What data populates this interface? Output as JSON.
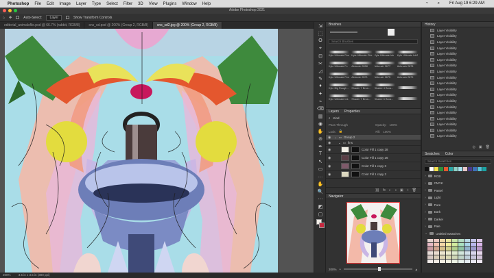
{
  "menubar": {
    "apple": "",
    "items": [
      "Photoshop",
      "File",
      "Edit",
      "Image",
      "Layer",
      "Type",
      "Select",
      "Filter",
      "3D",
      "View",
      "Plugins",
      "Window",
      "Help"
    ],
    "datetime": "Fri Aug 19  6:29 AM"
  },
  "window": {
    "title": "Adobe Photoshop 2021"
  },
  "options": {
    "auto_select": "Auto-Select:",
    "layer": "Layer",
    "show_transform": "Show Transform Controls"
  },
  "doc_tabs": [
    {
      "label": "editorial_animalsfile.psd @ 66.7% (rabbit, RGB/8)",
      "active": false
    },
    {
      "label": "sns_sd.psd @ 200% (Group 2, RGB/8)",
      "active": false
    },
    {
      "label": "sns_sd2.jpg @ 200% (Group 2, RGB/8)",
      "active": true
    }
  ],
  "tools": [
    "⇲",
    "⬚",
    "ʘ",
    "⌖",
    "⊡",
    "✂",
    "◿",
    "✎",
    "♦",
    "✦",
    "⌁",
    "⌫",
    "▥",
    "◉",
    "✋",
    "⊘",
    "✒",
    "T",
    "↖",
    "▭",
    "…",
    "✋",
    "🔍",
    "⋯",
    "◩",
    "▢"
  ],
  "brushes": {
    "title": "Brushes",
    "search": "Search Brushes",
    "items": [
      "Kyle Ultimate Pen",
      "Kyle Ultimate Chk",
      "Kyle Ultimate Ink",
      "Kyle Ultimate Ink2",
      "Kyle Ultimate Fx",
      "Airbrush 2658",
      "Airbrush 2677",
      "Airbrush 2678",
      "Kyle Ultimate Pen",
      "Airbrush 2671",
      "Airbrush 2675",
      "Airbrush 2679",
      "Kyle Big Rough ...",
      "Shader 7 Broa...",
      "Shader 4 Broa...",
      "",
      "Kyle Ultimate Ink ...",
      "Shader 7 Broa...",
      "Shader 6 Broa...",
      ""
    ]
  },
  "layers": {
    "tabs": [
      "Layers",
      "Properties"
    ],
    "kind": "Kind",
    "blend": "Pass Through",
    "opacity_label": "Opacity:",
    "opacity": "100%",
    "lock_label": "Lock:",
    "fill_label": "Fill:",
    "fill": "100%",
    "rows": [
      {
        "name": "Group 2",
        "type": "group",
        "active": true
      },
      {
        "name": "fins",
        "type": "group",
        "active": false
      },
      {
        "name": "Color Fill 1 copy 28",
        "type": "layer",
        "active": false
      },
      {
        "name": "Color Fill 1 copy 26",
        "type": "layer",
        "active": false
      },
      {
        "name": "Color Fill 1 copy 3",
        "type": "layer",
        "active": false
      },
      {
        "name": "Color Fill 1 copy 2",
        "type": "layer",
        "active": false
      }
    ],
    "footer": [
      "⛓",
      "fx",
      "◐",
      "◑",
      "▣",
      "+",
      "🗑"
    ]
  },
  "navigator": {
    "title": "Navigator",
    "zoom": "200%"
  },
  "history": {
    "title": "History",
    "items": [
      "Layer Visibility",
      "Layer Visibility",
      "Layer Visibility",
      "Layer Visibility",
      "Layer Visibility",
      "Layer Visibility",
      "Layer Visibility",
      "Layer Visibility",
      "Layer Visibility",
      "Layer Visibility",
      "Layer Visibility",
      "Layer Visibility",
      "Layer Visibility",
      "Layer Visibility",
      "Layer Visibility",
      "Layer Visibility",
      "Layer Visibility",
      "Layer Visibility",
      "Layer Visibility"
    ]
  },
  "swatches": {
    "tabs": [
      "Swatches",
      "Color"
    ],
    "search": "Search Swatches",
    "recent": [
      "#111111",
      "#ffffff",
      "#f4e04d",
      "#2d8f3c",
      "#e4572e",
      "#2ba7a7",
      "#8ed1c6",
      "#a6e2f0",
      "#e7c6c7",
      "#4b3b8c",
      "#3d6fb6",
      "#55c1d8",
      "#1aa4a4"
    ],
    "folders": [
      "RGB",
      "CMYK",
      "Pastel",
      "Light",
      "Pure",
      "Dark",
      "Darker",
      "Pale",
      "Untitled Swatches"
    ],
    "palette": [
      "#e8d3d0",
      "#ebc7c1",
      "#ecd6a6",
      "#e9e49f",
      "#c7e4a8",
      "#b5dcc3",
      "#b7d7e4",
      "#c2c2e6",
      "#dcc6e6",
      "#e6b8c4",
      "#f0c0b0",
      "#f4d7a6",
      "#f1ed9c",
      "#d3ec9f",
      "#a9e0c0",
      "#a8d4e8",
      "#bab8ec",
      "#dab6ea",
      "#c99aa0",
      "#d0a48f",
      "#d6c08a",
      "#d2d08c",
      "#b1cf8c",
      "#8fc2a4",
      "#92b3cc",
      "#9c9acb",
      "#bb97c8",
      "#e7dcd8",
      "#eadccf",
      "#ece5cf",
      "#ecebcd",
      "#dfebce",
      "#d2e7dc",
      "#d1e0ea",
      "#d8d5eb",
      "#e5d4ea",
      "#d5c7c2",
      "#d8ccb8",
      "#ddd4b4",
      "#dbd9b5",
      "#cfd8b7",
      "#c0d4c8",
      "#bfd0da",
      "#c6c4d9",
      "#d2c3d8",
      "#f2ecea",
      "#f3ede6",
      "#f4f0e4",
      "#f3f3e4",
      "#edf3e5",
      "#e7f1ec",
      "#e6eef3",
      "#eae9f3",
      "#f0e8f3"
    ]
  },
  "status": {
    "zoom": "200%",
    "dims": "3.5 in x 3.5 in (300 ppi)"
  }
}
